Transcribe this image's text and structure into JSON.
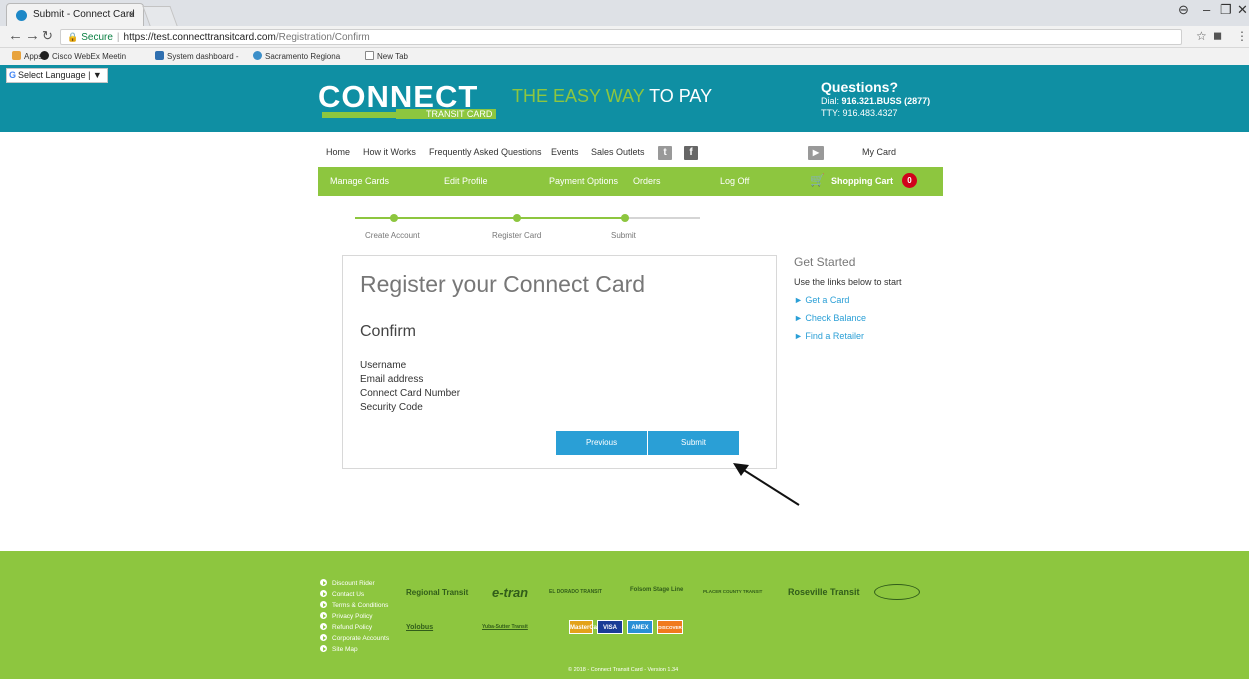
{
  "browser": {
    "tab_title": "Submit - Connect Card",
    "tab_close": "×",
    "url_secure": "Secure",
    "url_domain": "https://test.connecttransitcard.com",
    "url_path": "/Registration/Confirm",
    "bookmarks": [
      "Apps",
      "Cisco WebEx Meetin",
      "System dashboard -",
      "Sacramento Regiona",
      "New Tab"
    ]
  },
  "header": {
    "language_select": "Select Language",
    "logo_main": "CONNECT",
    "logo_sub": "TRANSIT CARD",
    "tagline_green": "THE EASY WAY",
    "tagline_white": "TO PAY",
    "questions": "Questions?",
    "dial_label": "Dial:",
    "dial_number": "916.321.BUSS (2877)",
    "tty": "TTY: 916.483.4327"
  },
  "topnav": {
    "items": [
      "Home",
      "How it Works",
      "Frequently Asked Questions",
      "Events",
      "Sales Outlets"
    ],
    "my_card": "My Card"
  },
  "greennav": {
    "items": [
      "Manage Cards",
      "Edit Profile",
      "Payment Options",
      "Orders",
      "Log Off"
    ],
    "cart_label": "Shopping Cart",
    "cart_count": "0"
  },
  "progress": {
    "steps": [
      "Create Account",
      "Register Card",
      "Submit"
    ]
  },
  "form": {
    "title": "Register your Connect Card",
    "subtitle": "Confirm",
    "fields": [
      "Username",
      "Email address",
      "Connect Card Number",
      "Security Code"
    ],
    "previous_label": "Previous",
    "submit_label": "Submit"
  },
  "sidebar": {
    "title": "Get Started",
    "desc": "Use the links below to start",
    "links": [
      "Get a Card",
      "Check Balance",
      "Find a Retailer"
    ]
  },
  "footer": {
    "links": [
      "Discount Rider",
      "Contact Us",
      "Terms & Conditions",
      "Privacy Policy",
      "Refund Policy",
      "Corporate Accounts",
      "Site Map"
    ],
    "agencies": [
      "Regional Transit",
      "e-tran",
      "EL DORADO TRANSIT",
      "Folsom Stage Line",
      "PLACER COUNTY TRANSIT",
      "Roseville Transit",
      "Yolobus",
      "Yuba-Sutter Transit"
    ],
    "payments": [
      "MasterCard",
      "VISA",
      "AMEX",
      "DISCOVER"
    ],
    "copyright": "© 2018 - Connect Transit Card - Version 1.34"
  }
}
